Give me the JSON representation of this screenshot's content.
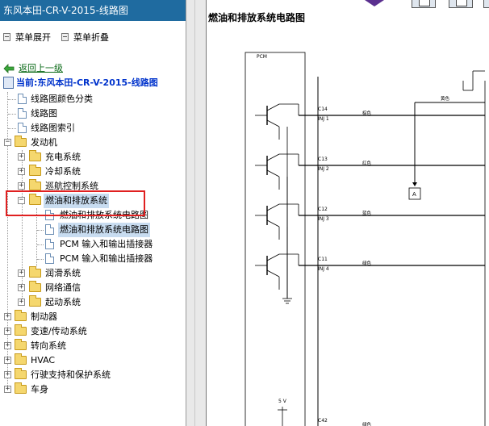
{
  "left_pane": {
    "title": "东风本田-CR-V-2015-线路图",
    "menu": {
      "expand_label": "菜单展开",
      "collapse_label": "菜单折叠"
    },
    "back_label": "返回上一级",
    "current_label": "当前:东风本田-CR-V-2015-线路图",
    "tree": {
      "doc_color": "线路图颜色分类",
      "doc_diagram": "线路图",
      "doc_index": "线路图索引",
      "engine": "发动机",
      "charging": "充电系统",
      "cooling": "冷却系统",
      "cruise": "巡航控制系统",
      "fuel_exhaust": "燃油和排放系统",
      "fuel_doc1": "燃油和排放系统电路图",
      "fuel_doc2": "燃油和排放系统电路图",
      "pcm1": "PCM 输入和输出插接器",
      "pcm2": "PCM 输入和输出插接器",
      "lubrication": "润滑系统",
      "network": "网络通信",
      "starting": "起动系统",
      "brakes": "制动器",
      "transmission": "变速/传动系统",
      "steering": "转向系统",
      "hvac": "HVAC",
      "driving_support": "行驶支持和保护系统",
      "body": "车身"
    },
    "highlight_color": "#e02020"
  },
  "right_pane": {
    "title": "燃油和排放系统电路图",
    "diagram": {
      "pcm_label": "PCM",
      "connectors": [
        {
          "pin": "C14",
          "inj": "INJ 1",
          "wire": "棕色"
        },
        {
          "pin": "C13",
          "inj": "INJ 2",
          "wire": "红色"
        },
        {
          "pin": "C12",
          "inj": "INJ 3",
          "wire": "蓝色"
        },
        {
          "pin": "C11",
          "inj": "INJ 4",
          "wire": "绿色"
        }
      ],
      "top_wire": "黄色",
      "node_a": "A",
      "supply": "5 V",
      "bottom_pin": "C42",
      "bottom_wire": "绿色"
    }
  },
  "colors": {
    "title_bar": "#1f6ba0",
    "link": "#0b6b18",
    "current": "#0033cc"
  }
}
